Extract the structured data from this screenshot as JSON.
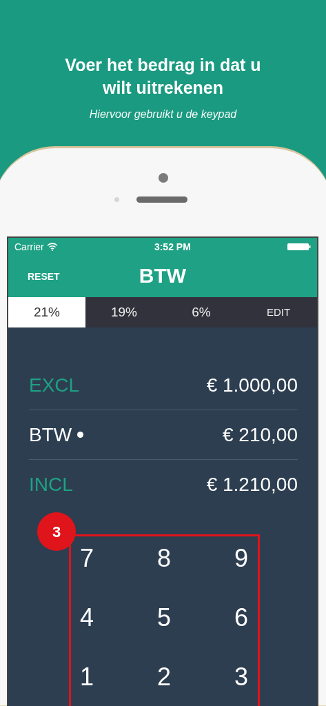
{
  "header": {
    "title": "Voer het bedrag in dat u wilt uitrekenen",
    "subtitle": "Hiervoor gebruikt u de keypad"
  },
  "status_bar": {
    "carrier": "Carrier",
    "time": "3:52 PM"
  },
  "nav_bar": {
    "left_button": "RESET",
    "title": "BTW"
  },
  "tabs": [
    {
      "label": "21%",
      "selected": true
    },
    {
      "label": "19%",
      "selected": false
    },
    {
      "label": "6%",
      "selected": false
    },
    {
      "label": "EDIT",
      "selected": false
    }
  ],
  "rows": [
    {
      "label": "EXCL",
      "value": "€ 1.000,00",
      "selected": false
    },
    {
      "label": "BTW",
      "value": "€ 210,00",
      "selected": true
    },
    {
      "label": "INCL",
      "value": "€ 1.210,00",
      "selected": false
    }
  ],
  "keypad": [
    "7",
    "8",
    "9",
    "4",
    "5",
    "6",
    "1",
    "2",
    "3"
  ],
  "callout": {
    "number": "3"
  }
}
